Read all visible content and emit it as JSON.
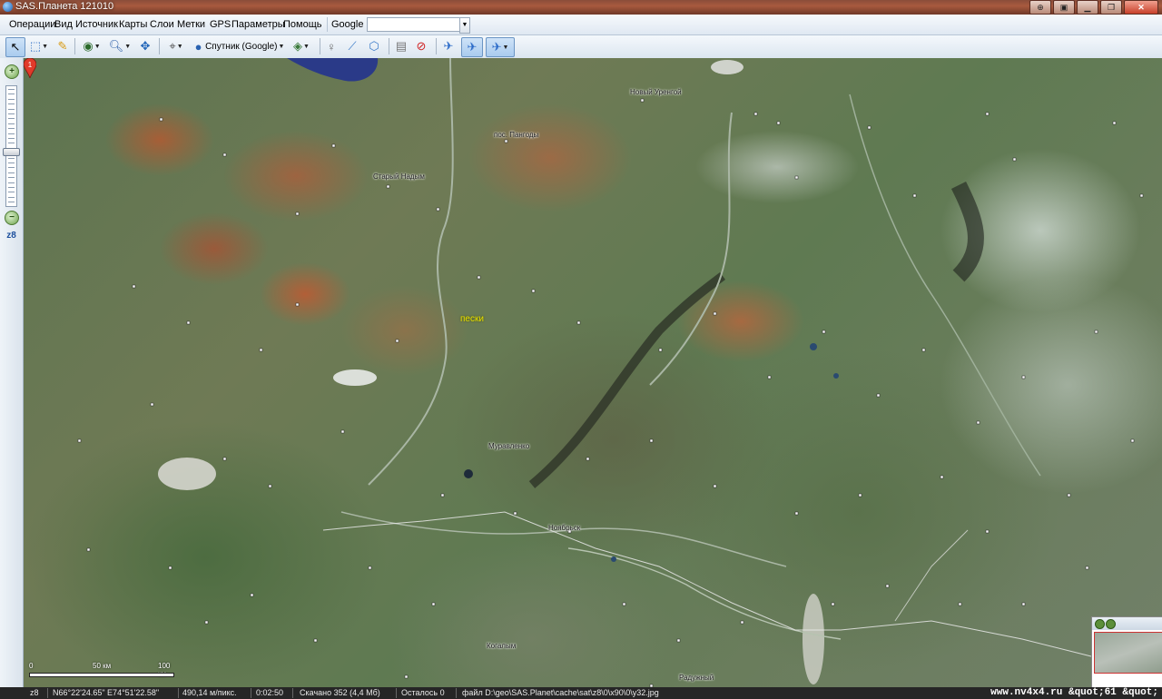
{
  "window": {
    "title": "SAS.Планета 121010"
  },
  "menubar": {
    "items": [
      "Операции",
      "Вид",
      "Источник",
      "Карты",
      "Слои",
      "Метки",
      "GPS",
      "Параметры",
      "Помощь"
    ],
    "search_source": "Google",
    "search_value": ""
  },
  "toolbar": {
    "map_type_label": "Спутник (Google)",
    "icons": [
      "cursor-icon",
      "selection-icon",
      "ruler-icon",
      "globe-icon",
      "zoom-icon",
      "fullscreen-icon",
      "gps-icon",
      "satellite-globe-icon",
      "layers-icon",
      "placemark-icon",
      "path-icon",
      "polygon-icon",
      "marks-list-icon",
      "delete-marks-icon",
      "gps-track-icon",
      "gps-center-icon",
      "gps-follow-icon"
    ]
  },
  "zoombar": {
    "zoom_level": "z8",
    "zoom_fraction": 0.55
  },
  "map": {
    "towns": [
      "Новый Уренгой",
      "пос. Пангоды",
      "Старый Надым",
      "Муравленко",
      "Ноябрьск",
      "Когалым",
      "Радужный"
    ],
    "placemark": {
      "number": "1",
      "name": "пески"
    },
    "scale": {
      "mid_label": "50 км",
      "end_label": "100 км",
      "start_label": "0"
    }
  },
  "status": {
    "zoom": "z8",
    "coordinates": "N66°22'24.65\" E74°51'22.58\"",
    "resolution": "490,14 м/пикс.",
    "time": "0:02:50",
    "downloaded": "Скачано 352 (4,4 Мб)",
    "remaining": "Осталось 0",
    "file": "файл D:\\geo\\SAS.Planet\\cache\\sat\\z8\\0\\x90\\0\\y32.jpg",
    "watermark": "www.nv4x4.ru &quot;61 &quot;"
  },
  "colors": {
    "title_bar": "#a85a3e",
    "placemark": "#e03a2a",
    "status_bg": "#262626"
  }
}
